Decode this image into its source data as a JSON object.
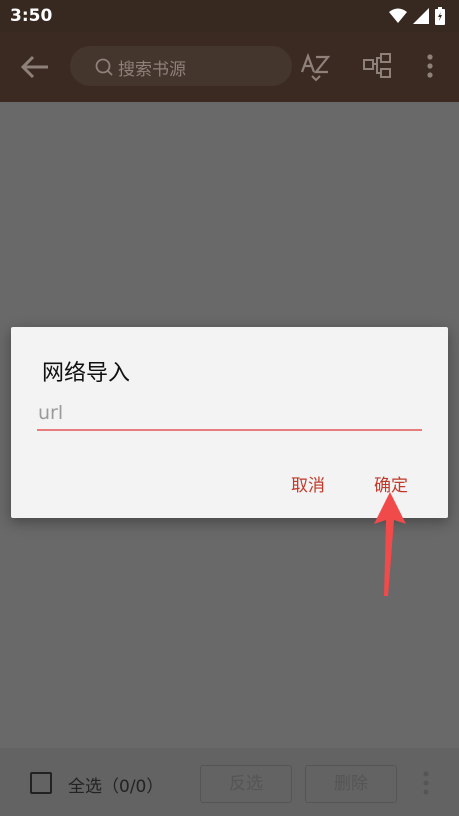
{
  "status_bar": {
    "time": "3:50"
  },
  "toolbar": {
    "search_placeholder": "搜索书源"
  },
  "dialog": {
    "title": "网络导入",
    "url_placeholder": "url",
    "url_value": "",
    "cancel_label": "取消",
    "confirm_label": "确定"
  },
  "bottom_bar": {
    "select_all_label": "全选（0/0）",
    "invert_label": "反选",
    "delete_label": "删除"
  },
  "colors": {
    "toolbar_bg": "#3b2a22",
    "accent": "#c0392b",
    "arrow": "#f04a4a"
  }
}
